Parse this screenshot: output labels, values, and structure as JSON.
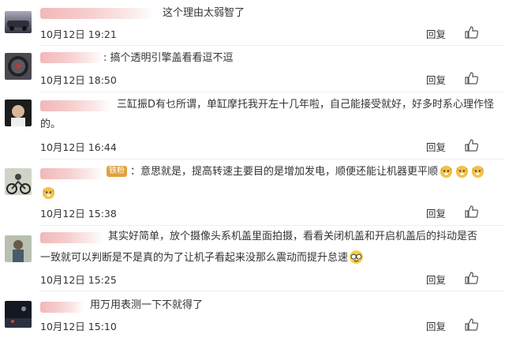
{
  "ui": {
    "reply_label": "回复",
    "like_icon": "thumbs-up-icon",
    "accent": "#e0a13f"
  },
  "comments": [
    {
      "text": "这个理由太弱智了",
      "date": "10月12日 19:21"
    },
    {
      "text": ": 搞个透明引擎盖看看逗不逗",
      "date": "10月12日 18:50"
    },
    {
      "text_line1": "三缸振D有乜所谓，单缸摩托我开左十几年啦，自己能接受就好，好多时系心理作怪",
      "text_line2": "的。",
      "date": "10月12日 16:44"
    },
    {
      "badge": "铁粉",
      "text": "：意思就是，提高转速主要目的是增加发电，顺便还能让机器更平顺",
      "emoji": "doge-emoji",
      "date": "10月12日 15:38"
    },
    {
      "text_line1": "其实好简单，放个摄像头系机盖里面拍摄，看看关闭机盖和开启机盖后的抖动是否",
      "text_line2": "一致就可以判断是不是真的为了让机子看起来没那么震动而提升怠速",
      "emoji": "glasses-emoji",
      "date": "10月12日 15:25"
    },
    {
      "text": "用万用表测一下不就得了",
      "date": "10月12日 15:10"
    }
  ]
}
